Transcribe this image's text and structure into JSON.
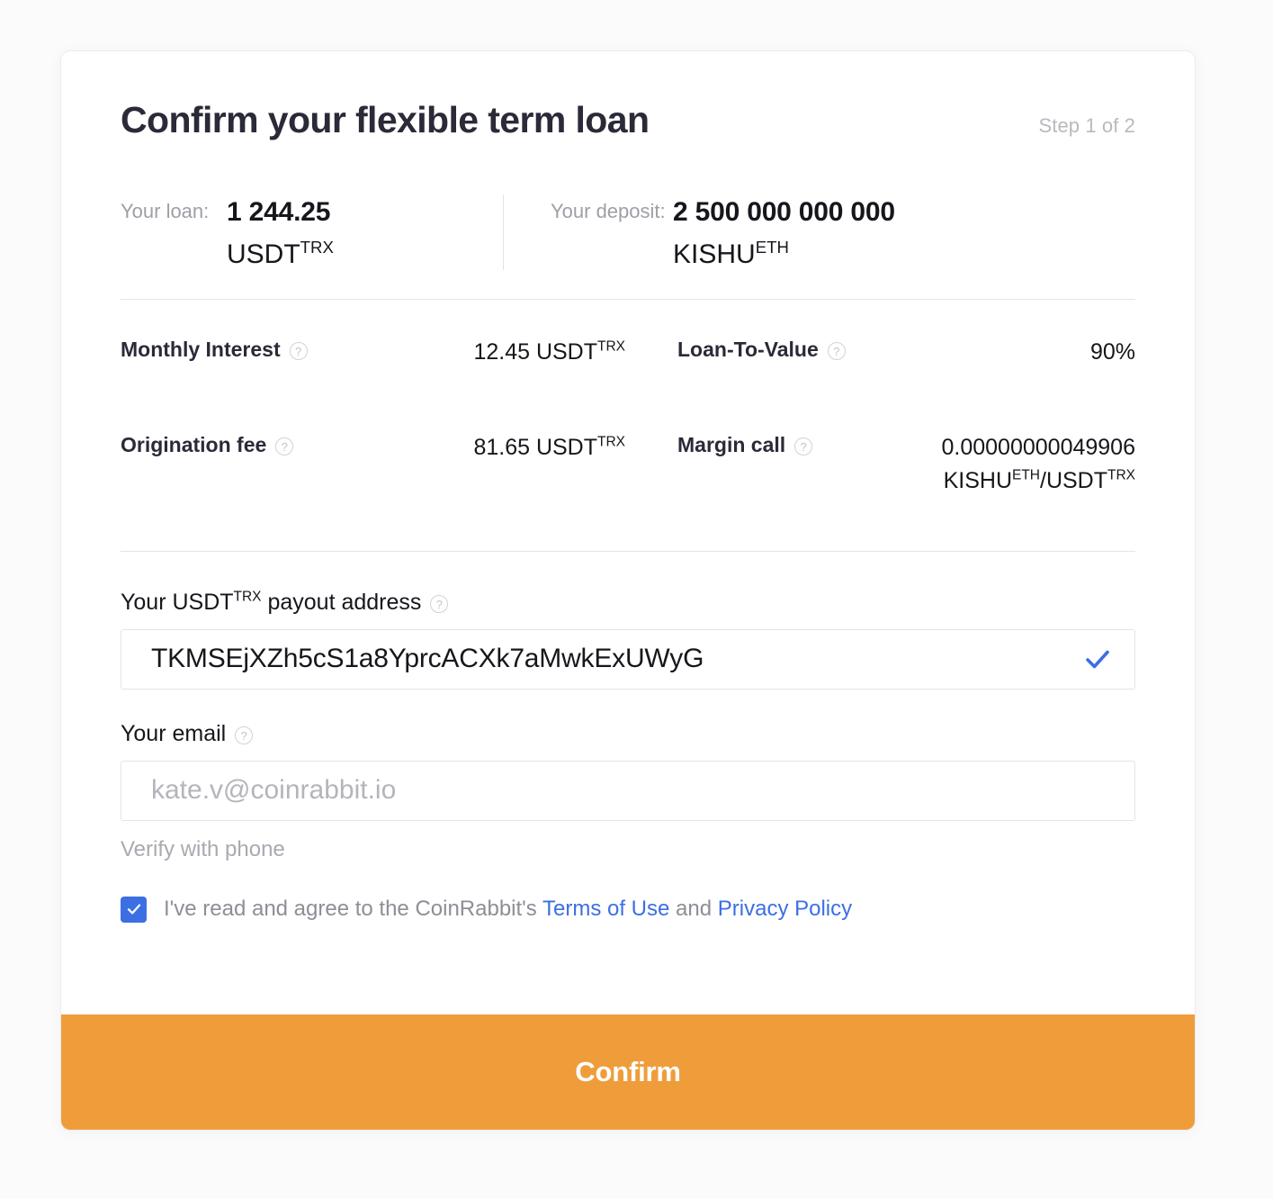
{
  "header": {
    "title": "Confirm your flexible term loan",
    "step": "Step 1 of 2"
  },
  "summary": {
    "loan": {
      "label": "Your loan:",
      "amount": "1 244.25",
      "ticker": "USDT",
      "ticker_sup": "TRX"
    },
    "deposit": {
      "label": "Your deposit:",
      "amount": "2 500 000 000 000",
      "ticker": "KISHU",
      "ticker_sup": "ETH"
    }
  },
  "details": {
    "monthly_interest": {
      "label": "Monthly Interest",
      "value_amount": "12.45 USDT",
      "value_sup": "TRX",
      "help": "?"
    },
    "loan_to_value": {
      "label": "Loan-To-Value",
      "value": "90%",
      "help": "?"
    },
    "origination_fee": {
      "label": "Origination fee",
      "value_amount": "81.65 USDT",
      "value_sup": "TRX",
      "help": "?"
    },
    "margin_call": {
      "label": "Margin call",
      "value_number": "0.00000000049906",
      "pair_base": "KISHU",
      "pair_base_sup": "ETH",
      "pair_sep": "/USDT",
      "pair_quote_sup": "TRX",
      "help": "?"
    }
  },
  "form": {
    "payout": {
      "label_prefix": "Your USDT",
      "label_sup": "TRX",
      "label_suffix": " payout address",
      "value": "TKMSEjXZh5cS1a8YprcACXk7aMwkExUWyG",
      "valid_icon": "checkmark-icon"
    },
    "email": {
      "label": "Your email",
      "value": "",
      "placeholder": "kate.v@coinrabbit.io"
    },
    "verify_phone": "Verify with phone",
    "agreement": {
      "checked": true,
      "text_before": "I've read and agree to the CoinRabbit's",
      "terms_link": "Terms of Use",
      "text_middle": "and",
      "privacy_link": "Privacy Policy"
    }
  },
  "footer": {
    "confirm_label": "Confirm"
  },
  "colors": {
    "accent_orange": "#ef9d3b",
    "link_blue": "#3c6fe4",
    "title_dark": "#2a2a38",
    "muted_gray": "#9e9ea6"
  }
}
